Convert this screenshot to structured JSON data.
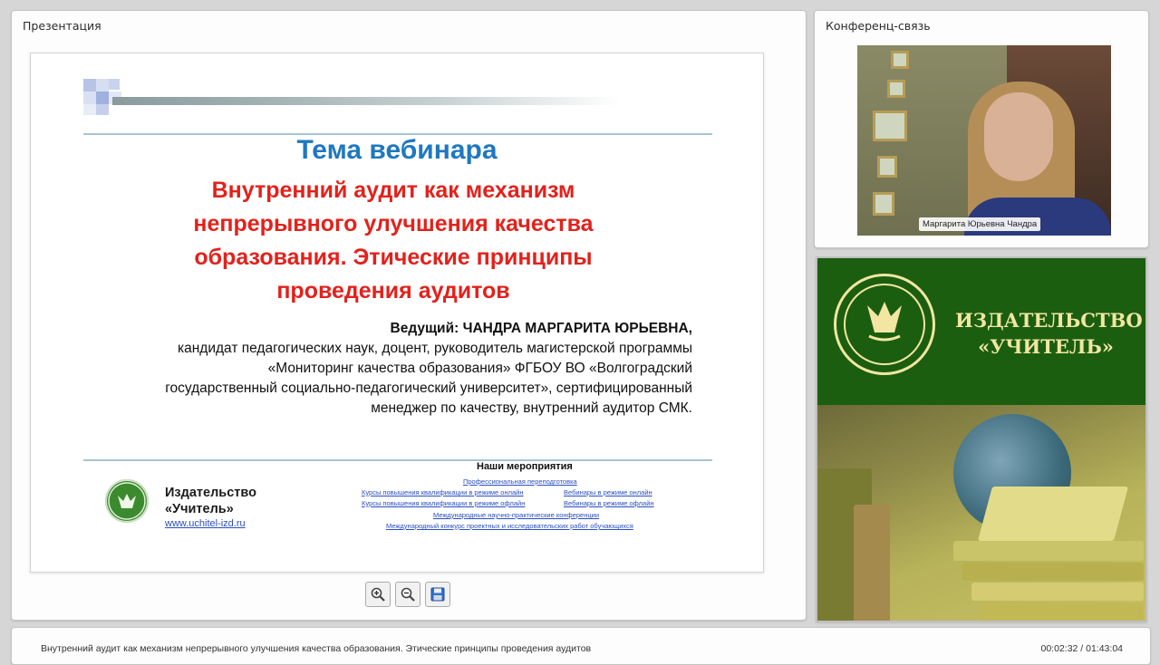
{
  "presentation": {
    "panel_title": "Презентация",
    "slide": {
      "topic": "Тема вебинара",
      "title_lines": [
        "Внутренний аудит как механизм",
        "непрерывного улучшения качества",
        "образования. Этические принципы",
        "проведения аудитов"
      ],
      "presenter_lead": "Ведущий: ЧАНДРА МАРГАРИТА ЮРЬЕВНА,",
      "presenter_lines": [
        "кандидат педагогических наук, доцент, руководитель магистерской программы",
        "«Мониторинг качества образования» ФГБОУ ВО «Волгоградский",
        "государственный социально-педагогический университет», сертифицированный",
        "менеджер по качеству, внутренний аудитор СМК."
      ],
      "publisher_line1": "Издательство",
      "publisher_line2": "«Учитель»",
      "publisher_url": "www.uchitel-izd.ru",
      "events_title": "Наши мероприятия",
      "events": {
        "prof": "Профессиональная переподготовка",
        "courses_online": "Курсы повышения квалификации в режиме онлайн",
        "webinars_online": "Вебинары в режиме онлайн",
        "courses_offline": "Курсы повышения квалификации в режиме офлайн",
        "webinars_offline": "Вебинары в режиме офлайн",
        "conferences": "Международные научно-практические конференции",
        "contest": "Международный конкурс проектных и исследовательских работ обучающихся"
      }
    },
    "tools": [
      "zoom-in-icon",
      "zoom-out-icon",
      "save-icon"
    ]
  },
  "conference": {
    "panel_title": "Конференц-связь",
    "participant_name": "Маргарита Юрьевна Чандра"
  },
  "ad": {
    "line1": "ИЗДАТЕЛЬСТВО",
    "line2": "«УЧИТЕЛЬ»",
    "accent_color": "#f2e6a2",
    "bg_color": "#1b5e10"
  },
  "status": {
    "title": "Внутренний аудит как механизм непрерывного улучшения качества образования. Этические принципы проведения аудитов",
    "time": "00:02:32 / 01:43:04"
  }
}
